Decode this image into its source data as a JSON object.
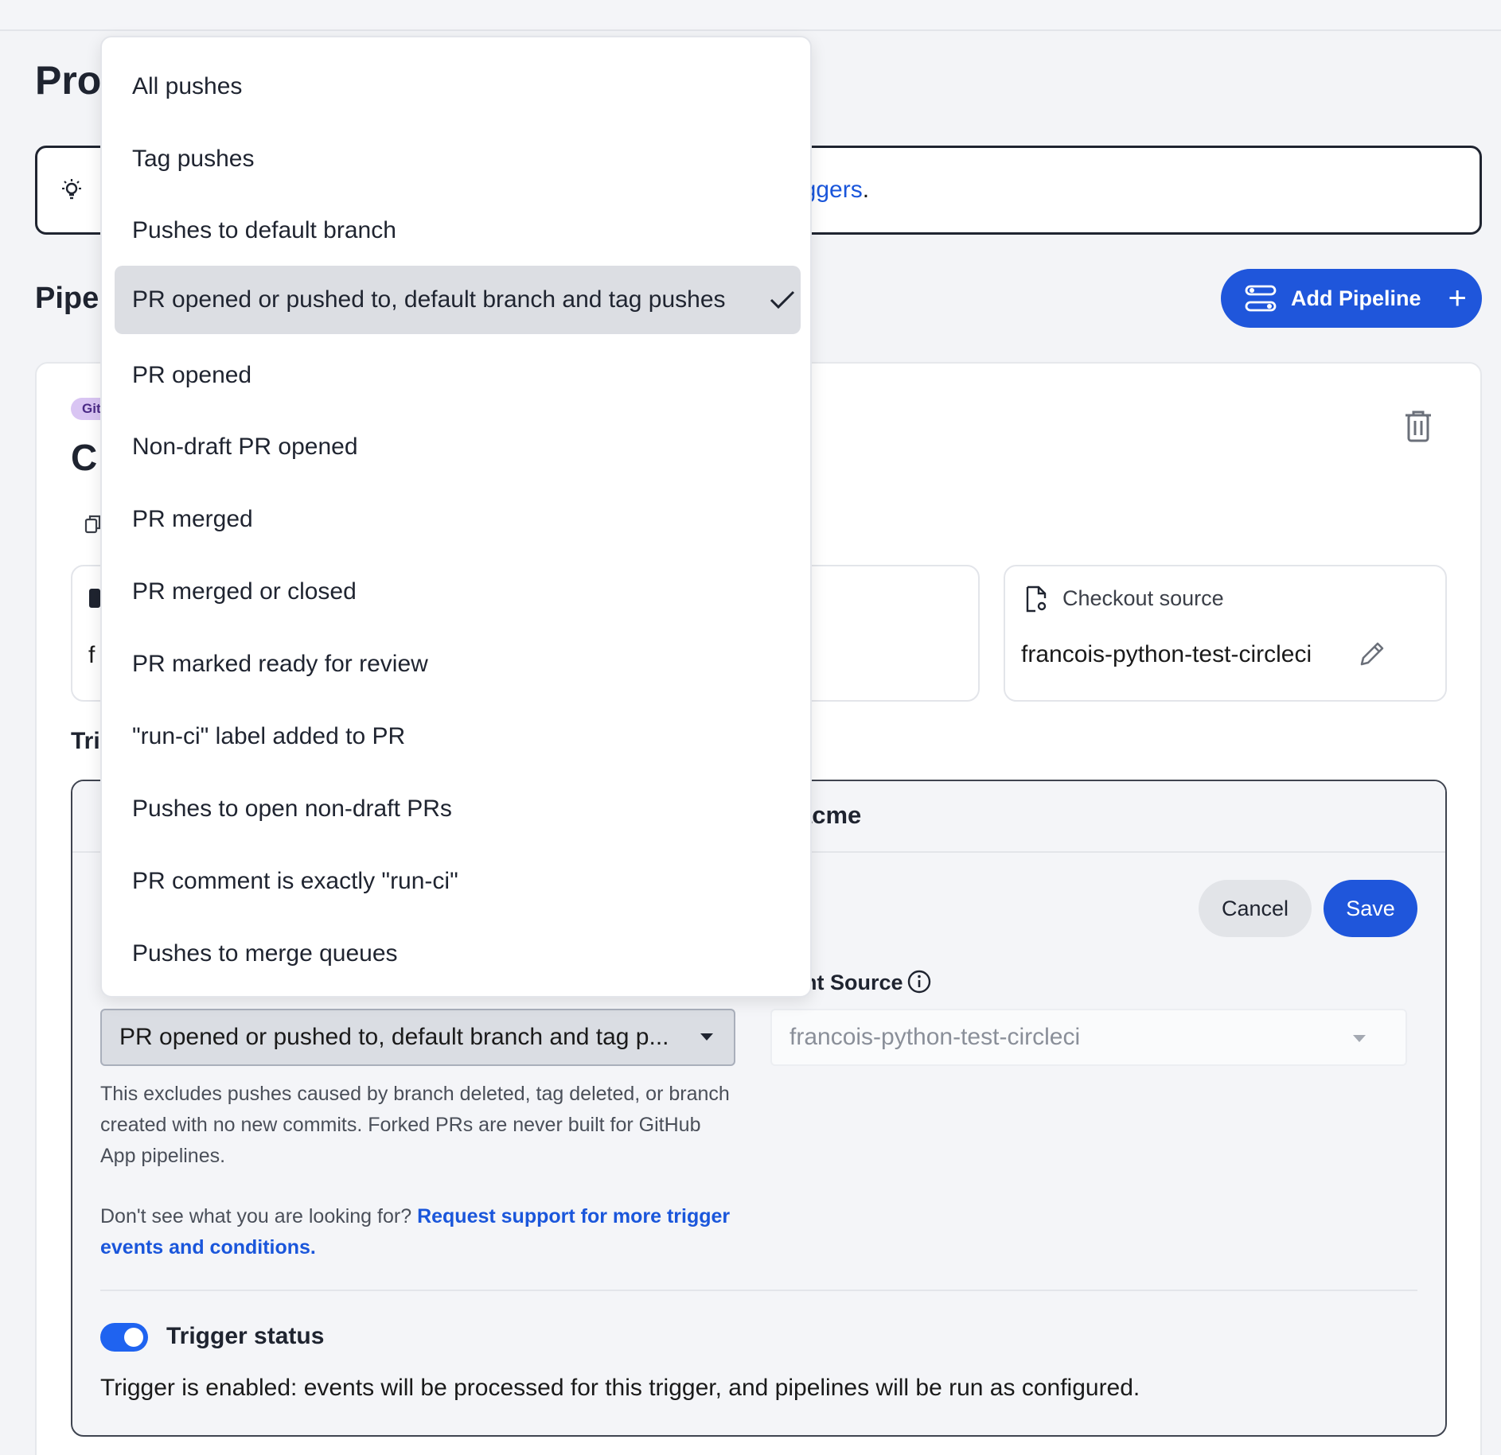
{
  "page": {
    "title": "Pro",
    "section_title": "Pipel",
    "add_pipeline_label": "Add Pipeline"
  },
  "banner": {
    "link_text": "riggers",
    "suffix": "."
  },
  "card": {
    "badge": "Git",
    "title": "C",
    "config_fragment": "f",
    "checkout": {
      "label": "Checkout source",
      "value": "francois-python-test-circleci"
    },
    "triggers_fragment": "Tri"
  },
  "trigger_panel": {
    "header_fragment": "acme",
    "cancel_label": "Cancel",
    "save_label": "Save",
    "source_label": "nt Source",
    "event_select_value": "PR opened or pushed to, default branch and tag p...",
    "source_select_value": "francois-python-test-circleci",
    "help_text": "This excludes pushes caused by branch deleted, tag deleted, or branch created with no new commits. Forked PRs are never built for GitHub App pipelines.",
    "support_prefix": "Don't see what you are looking for? ",
    "support_link": "Request support for more trigger events and conditions.",
    "status_label": "Trigger status",
    "status_desc": "Trigger is enabled: events will be processed for this trigger, and pipelines will be run as configured."
  },
  "dropdown": {
    "items": [
      {
        "label": "All pushes"
      },
      {
        "label": "Tag pushes"
      },
      {
        "label": "Pushes to default branch"
      },
      {
        "label": "PR opened or pushed to, default branch and tag pushes",
        "selected": true
      },
      {
        "label": "PR opened"
      },
      {
        "label": "Non-draft PR opened"
      },
      {
        "label": "PR merged"
      },
      {
        "label": "PR merged or closed"
      },
      {
        "label": "PR marked ready for review"
      },
      {
        "label": "\"run-ci\" label added to PR"
      },
      {
        "label": "Pushes to open non-draft PRs"
      },
      {
        "label": "PR comment is exactly \"run-ci\""
      },
      {
        "label": "Pushes to merge queues"
      }
    ]
  },
  "colors": {
    "accent": "#1f56db",
    "link": "#1a56db",
    "toggle_on": "#1f63f0",
    "badge_bg": "#d9c5f3"
  }
}
